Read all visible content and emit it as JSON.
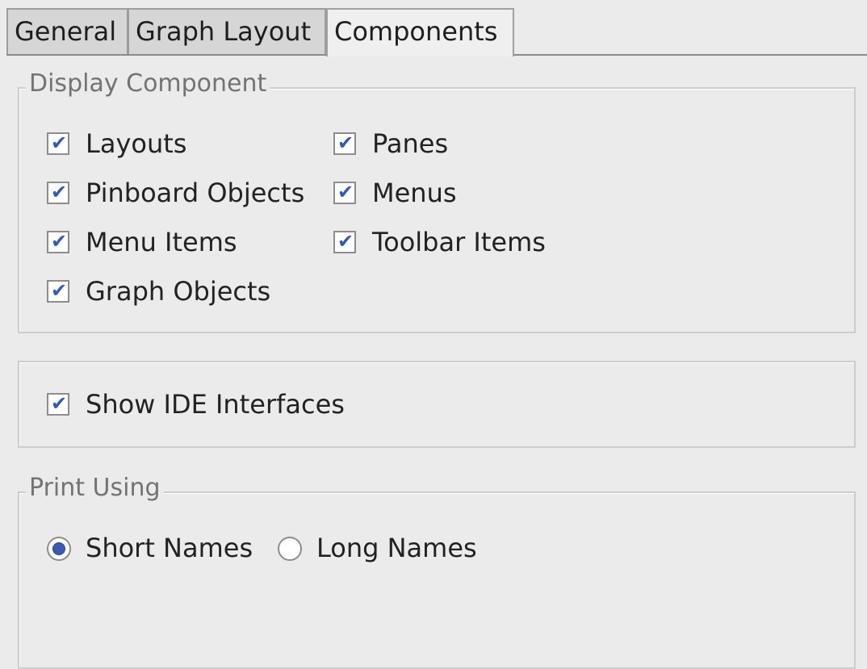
{
  "tabs": [
    {
      "label": "General",
      "active": false
    },
    {
      "label": "Graph Layout",
      "active": false
    },
    {
      "label": "Components",
      "active": true
    }
  ],
  "display_component": {
    "title": "Display Component",
    "options": [
      {
        "label": "Layouts",
        "checked": true
      },
      {
        "label": "Panes",
        "checked": true
      },
      {
        "label": "Pinboard Objects",
        "checked": true
      },
      {
        "label": "Menus",
        "checked": true
      },
      {
        "label": "Menu Items",
        "checked": true
      },
      {
        "label": "Toolbar Items",
        "checked": true
      },
      {
        "label": "Graph Objects",
        "checked": true
      }
    ]
  },
  "ide": {
    "show_ide_interfaces": {
      "label": "Show IDE Interfaces",
      "checked": true
    }
  },
  "print_using": {
    "title": "Print Using",
    "options": [
      {
        "label": "Short Names",
        "selected": true
      },
      {
        "label": "Long Names",
        "selected": false
      }
    ]
  },
  "icons": {
    "checkmark": "checkmark-icon",
    "radio_dot": "radio-selected-icon"
  },
  "colors": {
    "check_accent": "#3358b8",
    "background": "#ebebeb"
  }
}
